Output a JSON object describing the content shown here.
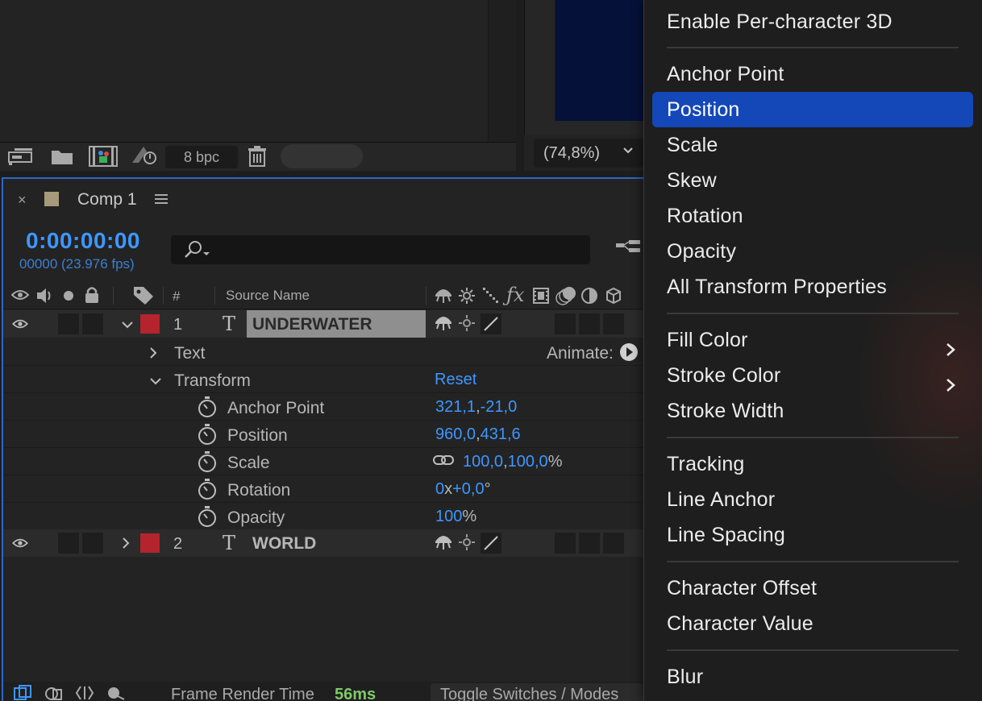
{
  "project_panel": {
    "bpc": "8 bpc"
  },
  "viewer": {
    "zoom": "(74,8%)"
  },
  "timeline": {
    "tab_close": "×",
    "comp_name": "Comp 1",
    "comp_color": "#a79a7a",
    "timecode": "0:00:00:00",
    "fps_text": "00000 (23.976 fps)",
    "headers": {
      "num": "#",
      "source_name": "Source Name"
    },
    "layers": [
      {
        "num": "1",
        "type_icon": "T",
        "name": "UNDERWATER",
        "label_color": "#b5232c",
        "expanded": true,
        "selected": true
      },
      {
        "num": "2",
        "type_icon": "T",
        "name": "WORLD",
        "label_color": "#b5232c",
        "expanded": false,
        "selected": false
      }
    ],
    "text_group": {
      "label": "Text",
      "animate_label": "Animate:"
    },
    "transform_group": {
      "label": "Transform",
      "reset": "Reset"
    },
    "properties": [
      {
        "label": "Anchor Point",
        "v1": "321,1",
        "sep": ",",
        "v2": "-21,0",
        "unit": ""
      },
      {
        "label": "Position",
        "v1": "960,0",
        "sep": ",",
        "v2": "431,6",
        "unit": ""
      },
      {
        "label": "Scale",
        "v1": "100,0",
        "sep": ",",
        "v2": "100,0",
        "unit": "%"
      },
      {
        "label": "Rotation",
        "v1": "0",
        "sep": "x",
        "v2": "+0,0",
        "unit": "°"
      },
      {
        "label": "Opacity",
        "v1": "100",
        "sep": "",
        "v2": "",
        "unit": "%"
      }
    ],
    "status": {
      "render_label": "Frame Render Time",
      "render_value": "56ms",
      "toggle_label": "Toggle Switches / Modes"
    }
  },
  "context_menu": {
    "active_color": "#1447b8",
    "items": [
      {
        "label": "Enable Per-character 3D",
        "submenu": false,
        "active": false
      },
      {
        "label": "Anchor Point",
        "submenu": false,
        "active": false
      },
      {
        "label": "Position",
        "submenu": false,
        "active": true
      },
      {
        "label": "Scale",
        "submenu": false,
        "active": false
      },
      {
        "label": "Skew",
        "submenu": false,
        "active": false
      },
      {
        "label": "Rotation",
        "submenu": false,
        "active": false
      },
      {
        "label": "Opacity",
        "submenu": false,
        "active": false
      },
      {
        "label": "All Transform Properties",
        "submenu": false,
        "active": false
      },
      {
        "label": "Fill Color",
        "submenu": true,
        "active": false
      },
      {
        "label": "Stroke Color",
        "submenu": true,
        "active": false
      },
      {
        "label": "Stroke Width",
        "submenu": false,
        "active": false
      },
      {
        "label": "Tracking",
        "submenu": false,
        "active": false
      },
      {
        "label": "Line Anchor",
        "submenu": false,
        "active": false
      },
      {
        "label": "Line Spacing",
        "submenu": false,
        "active": false
      },
      {
        "label": "Character Offset",
        "submenu": false,
        "active": false
      },
      {
        "label": "Character Value",
        "submenu": false,
        "active": false
      },
      {
        "label": "Blur",
        "submenu": false,
        "active": false
      }
    ]
  }
}
